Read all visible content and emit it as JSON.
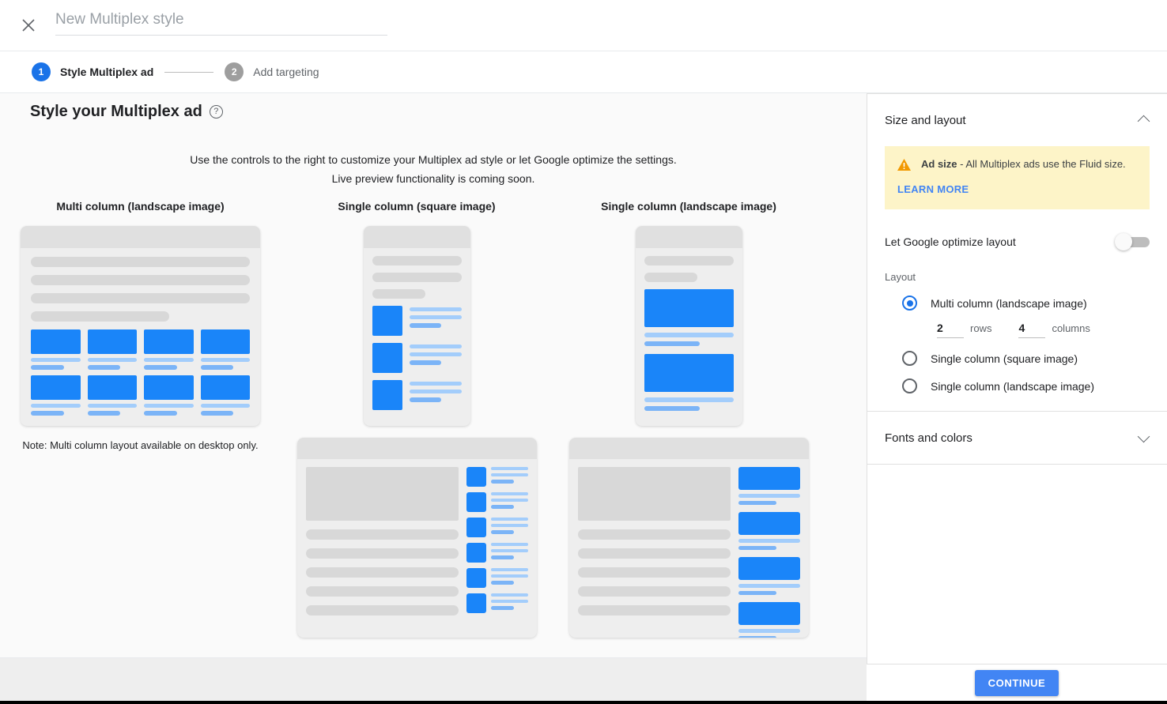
{
  "header": {
    "close_icon": "close-icon",
    "title_value": "",
    "title_placeholder": "New Multiplex style"
  },
  "stepper": {
    "steps": [
      {
        "number": "1",
        "label": "Style Multiplex ad",
        "active": true
      },
      {
        "number": "2",
        "label": "Add targeting",
        "active": false
      }
    ]
  },
  "main": {
    "page_title": "Style your Multiplex ad",
    "help_icon": "help-circle-icon",
    "help_glyph": "?",
    "subtitle_line1": "Use the controls to the right to customize your Multiplex ad style or let Google optimize the settings.",
    "subtitle_line2": "Live preview functionality is coming soon.",
    "previews": [
      {
        "heading": "Multi column (landscape image)"
      },
      {
        "heading": "Single column (square image)"
      },
      {
        "heading": "Single column (landscape image)"
      }
    ],
    "note": "Note: Multi column layout available on desktop only."
  },
  "panel": {
    "sections": [
      {
        "title": "Size and layout",
        "expanded": true,
        "chevron": "chevron-up-icon"
      },
      {
        "title": "Fonts and colors",
        "expanded": false,
        "chevron": "chevron-down-icon"
      }
    ],
    "notice": {
      "icon": "warning-triangle-icon",
      "bold": "Ad size",
      "text": " - All Multiplex ads use the Fluid size.",
      "link": "LEARN MORE",
      "bg_color": "#fdf4c8",
      "icon_color": "#f29900",
      "link_color": "#4285f4"
    },
    "optimize_toggle": {
      "label": "Let Google optimize layout",
      "checked": false
    },
    "layout_group_label": "Layout",
    "layout_options": [
      {
        "label": "Multi column (landscape image)",
        "selected": true
      },
      {
        "label": "Single column (square image)",
        "selected": false
      },
      {
        "label": "Single column (landscape image)",
        "selected": false
      }
    ],
    "rows": {
      "value": "2",
      "caption": "rows"
    },
    "columns": {
      "value": "4",
      "caption": "columns"
    },
    "accent_color": "#1a73e8"
  },
  "footer": {
    "continue_label": "CONTINUE",
    "button_color": "#4285f4"
  }
}
